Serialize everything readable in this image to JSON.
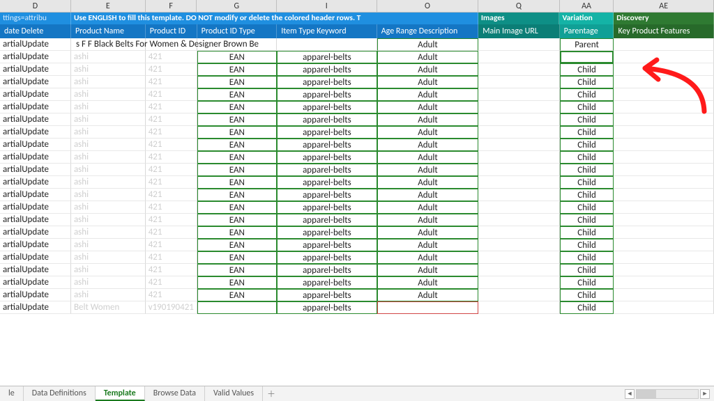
{
  "col_letters": [
    "D",
    "E",
    "F",
    "G",
    "I",
    "O",
    "Q",
    "AA",
    "AE"
  ],
  "banner": {
    "left_hint": "ttings=attribu",
    "message": "Use ENGLISH to fill this template. DO NOT modify or delete the colored header rows. T",
    "q": "Images",
    "aa": "Variation",
    "ae": "Discovery"
  },
  "subheaders": {
    "d": "date Delete",
    "e": "Product Name",
    "f": "Product ID",
    "g": "Product ID Type",
    "i": "Item Type Keyword",
    "o": "Age Range Description",
    "q": "Main Image URL",
    "aa": "Parentage",
    "ae": "Key Product Features"
  },
  "parent_row": {
    "d": "artialUpdate",
    "bleed": "s F             F      Black Belts For Women & Designer Brown Be",
    "o": "Adult",
    "aa": "Parent"
  },
  "child_rows_count": 21,
  "child_row": {
    "d": "artialUpdate",
    "e_faded": "ashi",
    "f_faded": "421",
    "g": "EAN",
    "i": "apparel-belts",
    "o": "Adult",
    "aa": "Child"
  },
  "selected_row_index": 0,
  "last_row": {
    "d": "artialUpdate",
    "e_faded": "Belt Women",
    "f_faded": "v190190421",
    "g": "",
    "i": "apparel-belts",
    "o": "",
    "aa": "Child"
  },
  "tabs": {
    "items": [
      "le",
      "Data Definitions",
      "Template",
      "Browse Data",
      "Valid Values"
    ],
    "active_index": 2,
    "add_label": "＋"
  }
}
